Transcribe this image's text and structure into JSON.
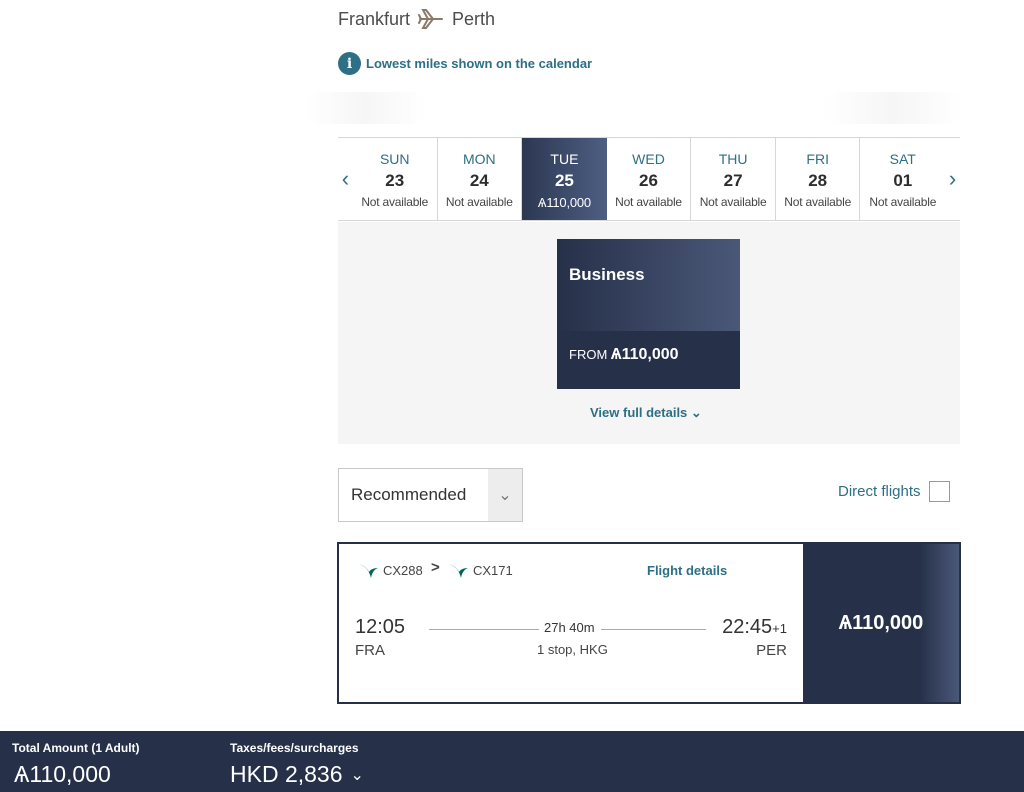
{
  "route": {
    "origin": "Frankfurt",
    "destination": "Perth"
  },
  "info_text": "Lowest miles shown on the calendar",
  "calendar": {
    "prev_icon": "chevron-left-icon",
    "next_icon": "chevron-right-icon",
    "days": [
      {
        "dow": "SUN",
        "date": "23",
        "status": "Not available",
        "selected": false
      },
      {
        "dow": "MON",
        "date": "24",
        "status": "Not available",
        "selected": false
      },
      {
        "dow": "TUE",
        "date": "25",
        "status": "Ѧ110,000",
        "selected": true
      },
      {
        "dow": "WED",
        "date": "26",
        "status": "Not available",
        "selected": false
      },
      {
        "dow": "THU",
        "date": "27",
        "status": "Not available",
        "selected": false
      },
      {
        "dow": "FRI",
        "date": "28",
        "status": "Not available",
        "selected": false
      },
      {
        "dow": "SAT",
        "date": "01",
        "status": "Not available",
        "selected": false
      }
    ]
  },
  "cabin": {
    "name": "Business",
    "from_label": "FROM",
    "price": "Ѧ110,000"
  },
  "view_details": "View full details",
  "sort": {
    "value": "Recommended"
  },
  "direct_label": "Direct flights",
  "flight": {
    "segments": [
      "CX288",
      "CX171"
    ],
    "separator": ">",
    "details_label": "Flight details",
    "dep_time": "12:05",
    "dep_code": "FRA",
    "arr_time": "22:45",
    "arr_offset": "+1",
    "arr_code": "PER",
    "duration": "27h 40m",
    "stops": "1 stop, HKG",
    "price": "Ѧ110,000"
  },
  "footer": {
    "total_label": "Total Amount (1 Adult)",
    "total_value": "Ѧ110,000",
    "tax_label": "Taxes/fees/surcharges",
    "tax_value": "HKD 2,836"
  },
  "colors": {
    "accent": "#2d6f84",
    "navy": "#263049",
    "navy_light": "#4a5878"
  }
}
